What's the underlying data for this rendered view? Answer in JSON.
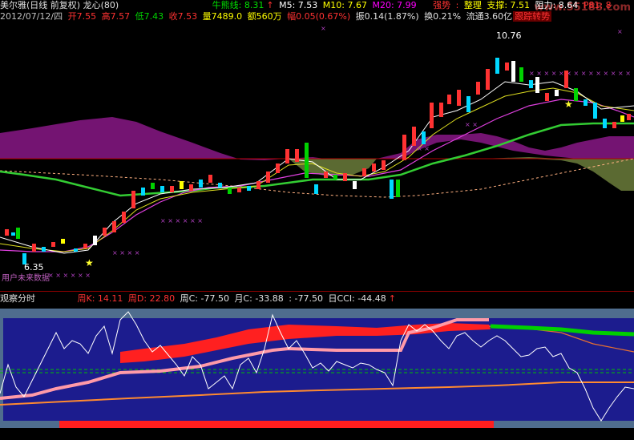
{
  "header": {
    "stock_name": "美尔雅(日线 前复权) 龙心(80)",
    "ind1_label": "牛熊线: 8.31",
    "ind1_arrow": "↑",
    "m5": "M5: 7.53",
    "m10": "M10: 7.67",
    "m20": "M20: 7.99",
    "strong_label": "强势",
    "sep1": ":",
    "organize_label": "整理",
    "support_label": "支撑: 7.51",
    "resistance_label": "阻力: 8.64",
    "p81_label": "P81: 8",
    "watermark": "www.55188.com"
  },
  "info_line": {
    "date": "2012/07/12/四",
    "open": "开7.55",
    "high": "高7.57",
    "low": "低7.43",
    "close": "收7.53",
    "volume": "量7489.0",
    "amount": "额560万",
    "change": "幅0.05(0.67%)",
    "amplitude": "振0.14(1.87%)",
    "turnover": "换0.21%",
    "float_shares": "流通3.60亿",
    "tag": "跟踪转势"
  },
  "annotations": {
    "high_price": "10.76",
    "low_price": "6.35",
    "future_data": "用户未来数据"
  },
  "sub_header": {
    "panel_name": "观察分时",
    "weekly_k": "周K: 14.11",
    "weekly_d": "周D: 22.80",
    "weekly_c": "周C: -77.50",
    "monthly_c": "月C: -33.88",
    "c_value": ": -77.50",
    "daily_cci": "日CCI: -44.48",
    "arrow": "↑"
  },
  "colors": {
    "red": "#ff3232",
    "green": "#00d200",
    "cyan": "#00d8ff",
    "yellow": "#ffff00",
    "purple": "#8a1a8a",
    "olive": "#5a6a30",
    "sub_bg": "#1c1c8c",
    "sub_band": "#4a6a8a"
  }
}
